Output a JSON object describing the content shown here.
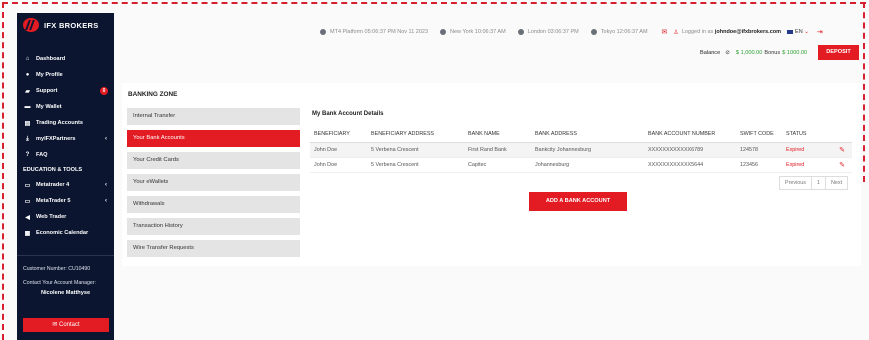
{
  "brand": {
    "name": "IFX BROKERS",
    "accent": "#e31b23",
    "sidebar_bg": "#0b1530"
  },
  "sidebar": {
    "items": [
      {
        "label": "Dashboard",
        "icon": "home-icon"
      },
      {
        "label": "My Profile",
        "icon": "user-icon"
      },
      {
        "label": "Support",
        "icon": "chat-icon",
        "badge": "0"
      },
      {
        "label": "My Wallet",
        "icon": "wallet-icon"
      },
      {
        "label": "Trading Accounts",
        "icon": "bank-icon"
      },
      {
        "label": "myIFXPartners",
        "icon": "download-icon",
        "arrow": "‹"
      },
      {
        "label": "FAQ",
        "icon": "question-icon"
      }
    ],
    "section_title": "EDUCATION & TOOLS",
    "tools": [
      {
        "label": "Metatrader 4",
        "icon": "laptop-icon",
        "arrow": "‹"
      },
      {
        "label": "MetaTrader 5",
        "icon": "laptop-icon",
        "arrow": "‹"
      },
      {
        "label": "Web Trader",
        "icon": "megaphone-icon"
      },
      {
        "label": "Economic Calendar",
        "icon": "calendar-icon"
      }
    ],
    "customer_number": "Customer Number: CU10490",
    "manager_label": "Contact Your Account Manager:",
    "manager_name": "Nicolene Matthyse",
    "contact_label": "✉ Contact"
  },
  "topbar": {
    "clocks": [
      "MT4 Platform 05:06:37 PM Nov 11 2023",
      "New York 10:06:37 AM",
      "London 03:06:37 PM",
      "Tokyo 12:06:37 AM"
    ],
    "logged_prefix": "Logged in as ",
    "email": "johndoe@ifxbrokers.com",
    "lang": "EN",
    "balance_label": "Balance",
    "balance_value": "$ 1,000.00",
    "bonus_label": "Bonus",
    "bonus_value": "$ 1000.00",
    "deposit_label": "DEPOSIT"
  },
  "main": {
    "title": "BANKING ZONE",
    "tabs": [
      {
        "label": "Internal Transfer",
        "active": false
      },
      {
        "label": "Your Bank Accounts",
        "active": true
      },
      {
        "label": "Your Credit Cards",
        "active": false
      },
      {
        "label": "Your eWallets",
        "active": false
      },
      {
        "label": "Withdrawals",
        "active": false
      },
      {
        "label": "Transaction History",
        "active": false
      },
      {
        "label": "Wire Transfer Requests",
        "active": false
      }
    ],
    "panel_title": "My Bank Account Details",
    "columns": [
      "BENEFICIARY",
      "BENEFICIARY ADDRESS",
      "BANK NAME",
      "BANK ADDRESS",
      "BANK ACCOUNT NUMBER",
      "SWIFT CODE",
      "STATUS"
    ],
    "rows": [
      [
        "John Doe",
        "5 Verbena Crescent",
        "First Rand Bank",
        "Bankcity Johannesburg",
        "XXXXXXXXXXXX6789",
        "124578",
        "Expired"
      ],
      [
        "John Doe",
        "5 Verbena Crescent",
        "Capitec",
        "Johannesburg",
        "XXXXXXXXXXXX5644",
        "123456",
        "Expired"
      ]
    ],
    "pager": {
      "prev": "Previous",
      "page": "1",
      "next": "Next"
    },
    "add_label": "ADD A BANK ACCOUNT"
  }
}
